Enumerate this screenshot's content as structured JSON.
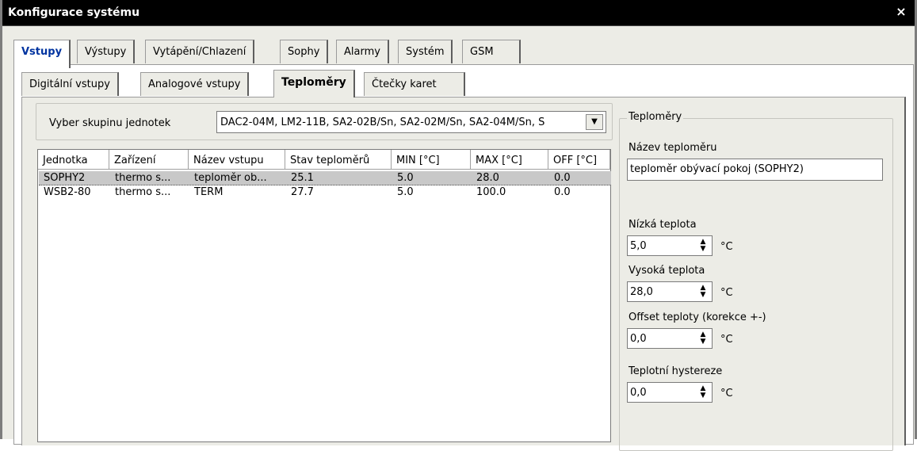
{
  "window": {
    "title": "Konfigurace systému",
    "close_glyph": "×"
  },
  "outer_tabs": [
    "Vstupy",
    "Výstupy",
    "Vytápění/Chlazení",
    "Sophy",
    "Alarmy",
    "Systém",
    "GSM"
  ],
  "inner_tabs": [
    "Digitální vstupy",
    "Analogové vstupy",
    "Teploměry",
    "Čtečky karet"
  ],
  "group_select": {
    "label": "Vyber skupinu jednotek",
    "value": "DAC2-04M, LM2-11B, SA2-02B/Sn, SA2-02M/Sn, SA2-04M/Sn, S",
    "dropdown_glyph": "▼"
  },
  "table": {
    "headers": [
      "Jednotka",
      "Zařízení",
      "Název vstupu",
      "Stav teploměrů",
      "MIN [°C]",
      "MAX [°C]",
      "OFF [°C]"
    ],
    "rows": [
      [
        "SOPHY2",
        "thermo s...",
        "teploměr ob...",
        "25.1",
        "5.0",
        "28.0",
        "0.0"
      ],
      [
        "WSB2-80",
        "thermo s...",
        "TERM",
        "27.7",
        "5.0",
        "100.0",
        "0.0"
      ]
    ]
  },
  "details": {
    "group_title": "Teploměry",
    "name_label": "Název teploměru",
    "name_value": "teploměr obývací pokoj (SOPHY2)",
    "low_label": "Nízká teplota",
    "low_value": "5,0",
    "high_label": "Vysoká teplota",
    "high_value": "28,0",
    "offset_label": "Offset teploty (korekce +-)",
    "offset_value": "0,0",
    "hyst_label": "Teplotní hystereze",
    "hyst_value": "0,0",
    "unit": "°C",
    "spin_up": "▲",
    "spin_down": "▼"
  }
}
